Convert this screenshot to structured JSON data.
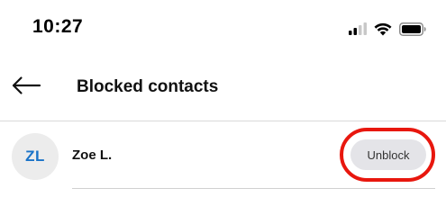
{
  "status_bar": {
    "time": "10:27",
    "icons": [
      "signal-icon",
      "wifi-icon",
      "battery-icon"
    ]
  },
  "header": {
    "back_icon": "back-arrow-icon",
    "title": "Blocked contacts"
  },
  "contacts": [
    {
      "initials": "ZL",
      "name": "Zoe L.",
      "action_label": "Unblock"
    }
  ],
  "colors": {
    "avatar_text": "#1a73c8",
    "avatar_bg": "#ececec",
    "highlight_ring": "#e8170e",
    "button_bg": "#e4e4e8"
  }
}
